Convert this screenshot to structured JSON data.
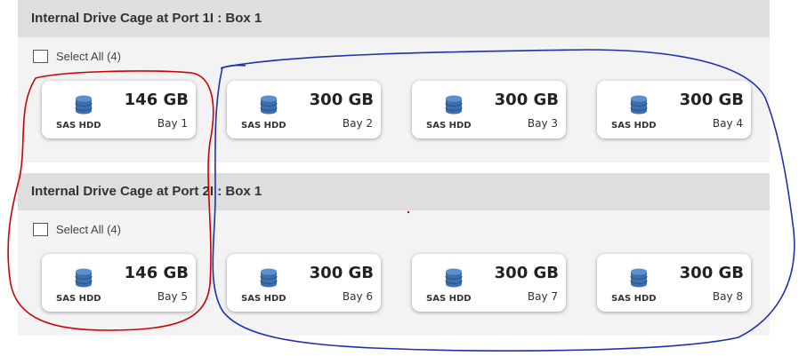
{
  "cages": [
    {
      "title": "Internal Drive Cage at Port 1I : Box 1",
      "select_all_label": "Select All (4)",
      "drives": [
        {
          "capacity": "146 GB",
          "type": "SAS HDD",
          "bay": "Bay 1"
        },
        {
          "capacity": "300 GB",
          "type": "SAS HDD",
          "bay": "Bay 2"
        },
        {
          "capacity": "300 GB",
          "type": "SAS HDD",
          "bay": "Bay 3"
        },
        {
          "capacity": "300 GB",
          "type": "SAS HDD",
          "bay": "Bay 4"
        }
      ]
    },
    {
      "title": "Internal Drive Cage at Port 2I : Box 1",
      "select_all_label": "Select All (4)",
      "drives": [
        {
          "capacity": "146 GB",
          "type": "SAS HDD",
          "bay": "Bay 5"
        },
        {
          "capacity": "300 GB",
          "type": "SAS HDD",
          "bay": "Bay 6"
        },
        {
          "capacity": "300 GB",
          "type": "SAS HDD",
          "bay": "Bay 7"
        },
        {
          "capacity": "300 GB",
          "type": "SAS HDD",
          "bay": "Bay 8"
        }
      ]
    }
  ],
  "drive_icon": "database-disk-icon",
  "colors": {
    "header_bg": "#dedede",
    "panel_bg": "#f3f3f3",
    "drive_icon": "#4a7fc0",
    "annotation_red": "#d00000",
    "annotation_blue": "#1f2fb0"
  }
}
